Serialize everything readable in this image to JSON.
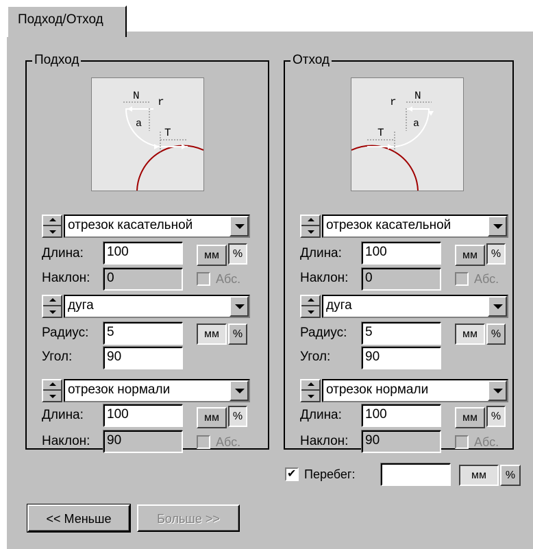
{
  "tab": {
    "label": "Подход/Отход"
  },
  "approach": {
    "caption": "Подход",
    "diagram": {
      "labels": [
        "N",
        "r",
        "a",
        "T"
      ]
    },
    "segment1": {
      "combo": "отрезок касательной",
      "length_label": "Длина:",
      "length_value": "100",
      "incline_label": "Наклон:",
      "incline_value": "0",
      "mm": "мм",
      "pct": "%",
      "abs_label": "Абс.",
      "abs_checked": false
    },
    "arc": {
      "combo": "дуга",
      "radius_label": "Радиус:",
      "radius_value": "5",
      "angle_label": "Угол:",
      "angle_value": "90",
      "mm": "мм",
      "pct": "%"
    },
    "segment2": {
      "combo": "отрезок нормали",
      "length_label": "Длина:",
      "length_value": "100",
      "incline_label": "Наклон:",
      "incline_value": "90",
      "mm": "мм",
      "pct": "%",
      "abs_label": "Абс.",
      "abs_checked": false
    }
  },
  "retract": {
    "caption": "Отход",
    "diagram": {
      "labels": [
        "r",
        "N",
        "T",
        "a"
      ]
    },
    "segment1": {
      "combo": "отрезок касательной",
      "length_label": "Длина:",
      "length_value": "100",
      "incline_label": "Наклон:",
      "incline_value": "0",
      "mm": "мм",
      "pct": "%",
      "abs_label": "Абс.",
      "abs_checked": false
    },
    "arc": {
      "combo": "дуга",
      "radius_label": "Радиус:",
      "radius_value": "5",
      "angle_label": "Угол:",
      "angle_value": "90",
      "mm": "мм",
      "pct": "%"
    },
    "segment2": {
      "combo": "отрезок нормали",
      "length_label": "Длина:",
      "length_value": "100",
      "incline_label": "Наклон:",
      "incline_value": "90",
      "mm": "мм",
      "pct": "%",
      "abs_label": "Абс.",
      "abs_checked": false
    }
  },
  "overrun": {
    "label": "Перебег:",
    "checked": true,
    "value": "",
    "mm": "мм",
    "pct": "%"
  },
  "buttons": {
    "less": "<< Меньше",
    "more": "Больше >>"
  },
  "colors": {
    "face": "#c0c0c0",
    "arc_red": "#a00000",
    "diagram_bg": "#e6e6e6"
  }
}
